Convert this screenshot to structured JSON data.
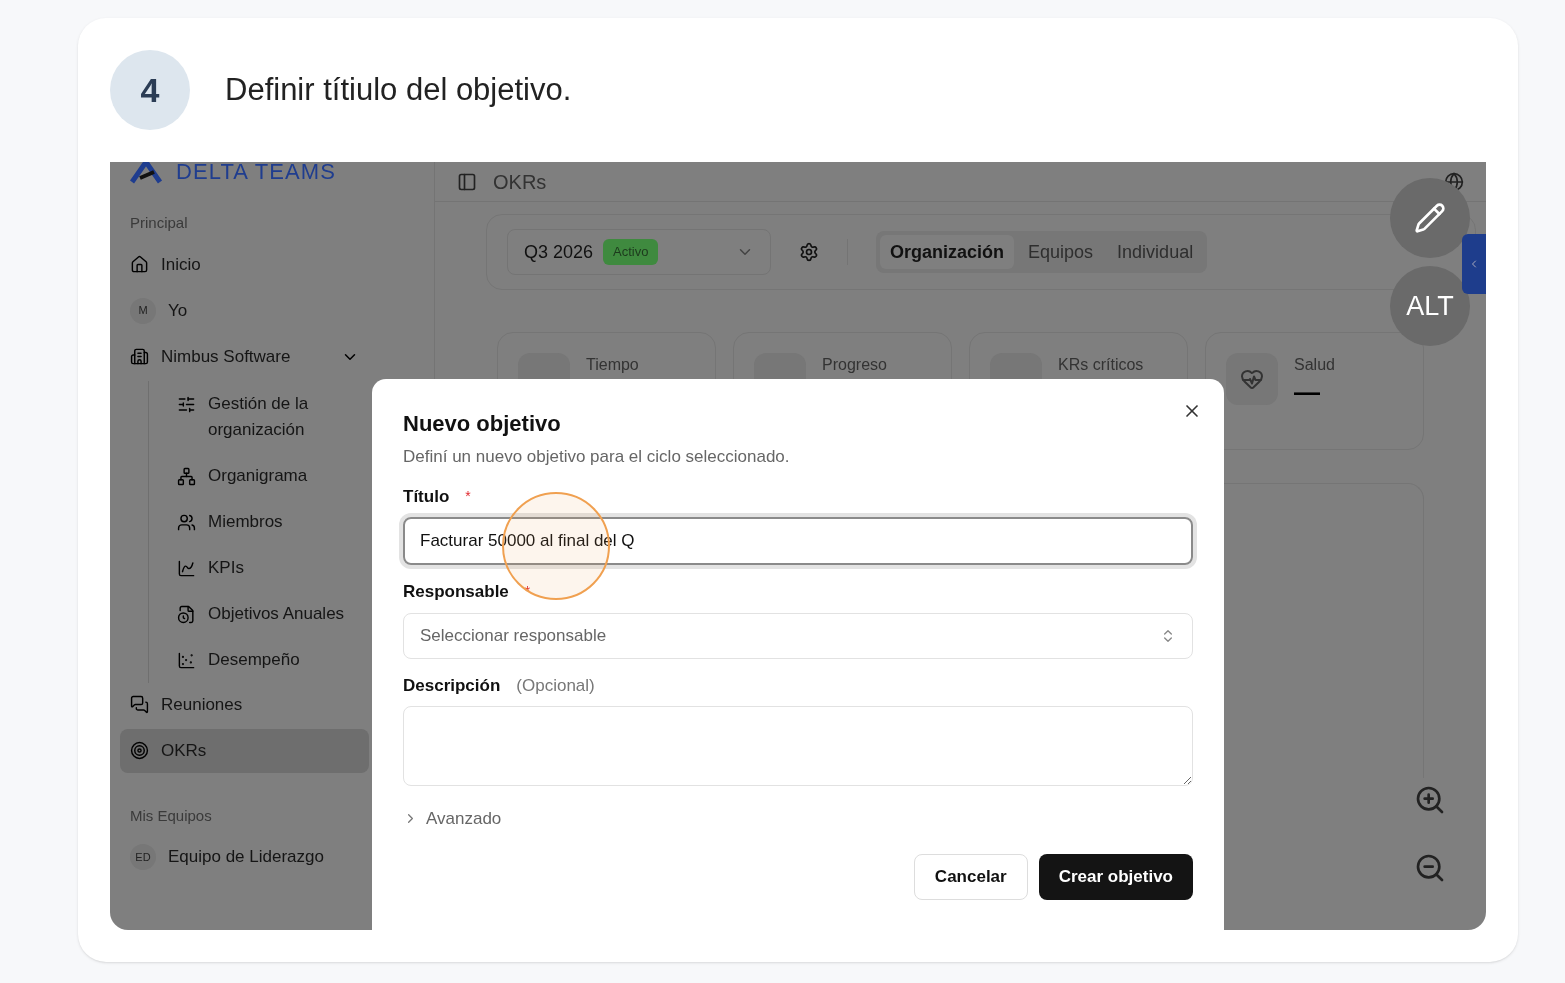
{
  "step": {
    "number": "4",
    "text": "Definir títiulo del objetivo."
  },
  "app": {
    "brand": "DELTA TEAMS",
    "header": {
      "title": "OKRs"
    },
    "sidebar": {
      "sections": [
        {
          "title": "Principal",
          "items": [
            {
              "kind": "link",
              "label": "Inicio",
              "selected": false
            },
            {
              "kind": "avatar",
              "avatar": "M",
              "label": "Yo",
              "selected": false
            },
            {
              "kind": "group",
              "label": "Nimbus Software",
              "selected": false,
              "expanded": true,
              "children": [
                {
                  "label": "Gestión de la organización",
                  "selected": false
                },
                {
                  "label": "Organigrama",
                  "selected": false
                },
                {
                  "label": "Miembros",
                  "selected": false
                },
                {
                  "label": "KPIs",
                  "selected": false
                },
                {
                  "label": "Objetivos Anuales",
                  "selected": false
                },
                {
                  "label": "Desempeño",
                  "selected": false
                }
              ]
            },
            {
              "kind": "link",
              "label": "Reuniones",
              "selected": false
            },
            {
              "kind": "link",
              "label": "OKRs",
              "selected": true
            }
          ]
        },
        {
          "title": "Mis Equipos",
          "items": [
            {
              "kind": "avatar",
              "avatar": "ED",
              "label": "Equipo de Liderazgo",
              "selected": false
            }
          ]
        }
      ]
    },
    "toolbar": {
      "cycle": "Q3 2026",
      "badge": "Activo",
      "view_tabs": [
        {
          "label": "Organización",
          "selected": true
        },
        {
          "label": "Equipos",
          "selected": false
        },
        {
          "label": "Individual",
          "selected": false
        }
      ]
    },
    "stats": [
      {
        "label": "Tiempo"
      },
      {
        "label": "Progreso"
      },
      {
        "label": "KRs críticos"
      },
      {
        "label": "Salud",
        "value": "—"
      }
    ],
    "floating": {
      "alt_label": "ALT"
    }
  },
  "modal": {
    "title": "Nuevo objetivo",
    "subtitle": "Definí un nuevo objetivo para el ciclo seleccionado.",
    "fields": [
      {
        "kind": "text",
        "label": "Título",
        "required_mark": "*",
        "value": "Facturar 50000 al final del Q"
      },
      {
        "kind": "select",
        "label": "Responsable",
        "required_mark": "*",
        "placeholder": "Seleccionar responsable"
      },
      {
        "kind": "textarea",
        "label": "Descripción",
        "hint": "(Opcional)"
      }
    ],
    "advanced": {
      "label": "Avanzado",
      "expanded": false
    },
    "buttons": [
      {
        "kind": "secondary",
        "label": "Cancelar"
      },
      {
        "kind": "primary",
        "label": "Crear objetivo"
      }
    ]
  }
}
